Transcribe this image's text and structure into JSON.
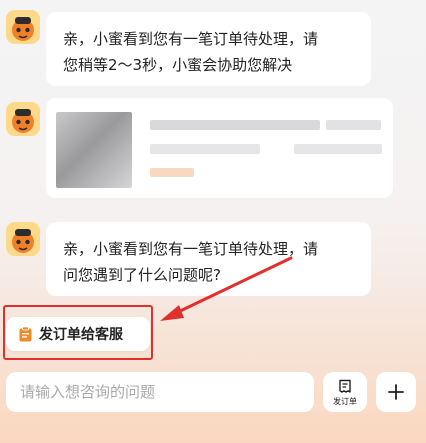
{
  "messages": [
    {
      "lines": [
        "亲，小蜜看到您有一笔订单待处理，请",
        "您稍等2～3秒，小蜜会协助您解决"
      ]
    },
    {
      "lines": [
        "亲，小蜜看到您有一笔订单待处理，请",
        "问您遇到了什么问题呢?"
      ]
    }
  ],
  "quick_reply": {
    "label": "发订单给客服",
    "icon": "order-clipboard-icon"
  },
  "composer": {
    "placeholder": "请输入想咨询的问题",
    "order_button_label": "发订单",
    "plus_icon": "plus-icon"
  },
  "colors": {
    "highlight_annotation": "#e0302e",
    "quick_reply_icon": "#f08a24",
    "avatar_bg": "#ffd98a"
  }
}
